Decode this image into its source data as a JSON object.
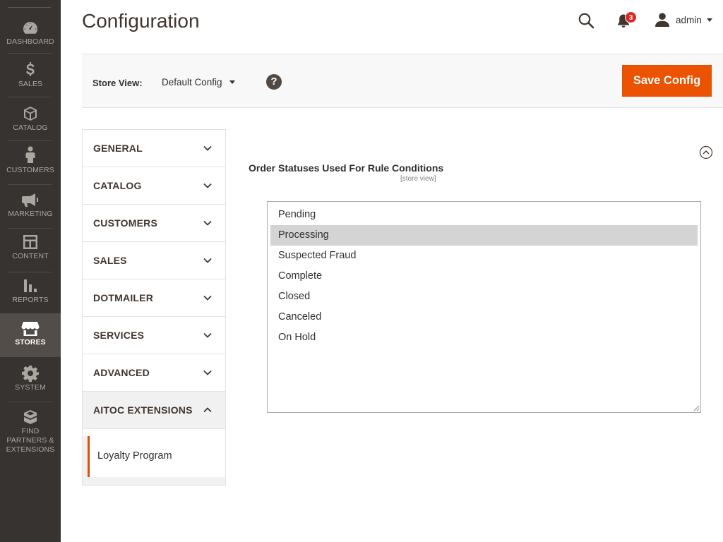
{
  "sidebar": {
    "items": [
      {
        "label": "DASHBOARD",
        "icon": "dashboard-icon"
      },
      {
        "label": "SALES",
        "icon": "dollar-icon"
      },
      {
        "label": "CATALOG",
        "icon": "box-icon"
      },
      {
        "label": "CUSTOMERS",
        "icon": "person-icon"
      },
      {
        "label": "MARKETING",
        "icon": "megaphone-icon"
      },
      {
        "label": "CONTENT",
        "icon": "content-icon"
      },
      {
        "label": "REPORTS",
        "icon": "bar-chart-icon"
      },
      {
        "label": "STORES",
        "icon": "storefront-icon"
      },
      {
        "label": "SYSTEM",
        "icon": "gear-icon"
      },
      {
        "label": "FIND PARTNERS & EXTENSIONS",
        "icon": "extensions-icon"
      }
    ],
    "active": "STORES"
  },
  "header": {
    "title": "Configuration",
    "notification_count": "3",
    "user_name": "admin"
  },
  "scope": {
    "label": "Store View:",
    "value": "Default Config",
    "save_label": "Save Config"
  },
  "tabs": [
    {
      "label": "GENERAL"
    },
    {
      "label": "CATALOG"
    },
    {
      "label": "CUSTOMERS"
    },
    {
      "label": "SALES"
    },
    {
      "label": "DOTMAILER"
    },
    {
      "label": "SERVICES"
    },
    {
      "label": "ADVANCED"
    },
    {
      "label": "AITOC EXTENSIONS"
    }
  ],
  "subitem": {
    "label": "Loyalty Program"
  },
  "field": {
    "label": "Order Statuses Used For Rule Conditions",
    "scope": "[store view]",
    "options": [
      "Pending",
      "Processing",
      "Suspected Fraud",
      "Complete",
      "Closed",
      "Canceled",
      "On Hold"
    ],
    "selected": "Processing"
  },
  "colors": {
    "sidebar_bg": "#373330",
    "accent": "#eb5202",
    "badge": "#e22626"
  }
}
